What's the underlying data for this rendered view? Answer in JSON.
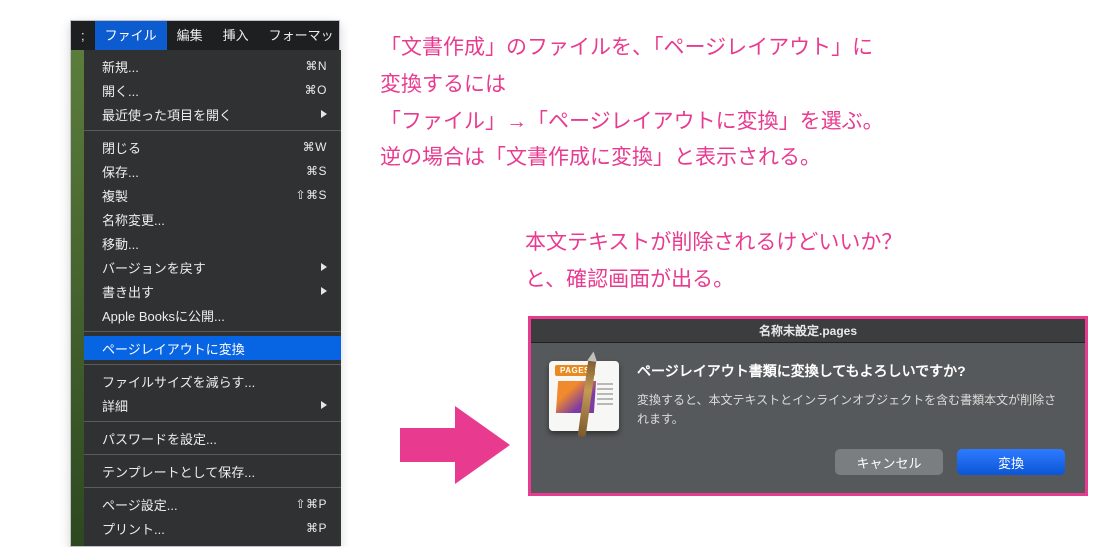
{
  "menubar": {
    "trail": ";",
    "items": [
      "ファイル",
      "編集",
      "挿入",
      "フォーマッ"
    ]
  },
  "menu": {
    "new": {
      "label": "新規...",
      "shortcut": "⌘N"
    },
    "open": {
      "label": "開く...",
      "shortcut": "⌘O"
    },
    "recent": {
      "label": "最近使った項目を開く"
    },
    "close": {
      "label": "閉じる",
      "shortcut": "⌘W"
    },
    "save": {
      "label": "保存...",
      "shortcut": "⌘S"
    },
    "duplicate": {
      "label": "複製",
      "shortcut": "⇧⌘S"
    },
    "rename": {
      "label": "名称変更..."
    },
    "move": {
      "label": "移動..."
    },
    "revert": {
      "label": "バージョンを戻す"
    },
    "export": {
      "label": "書き出す"
    },
    "applebooks": {
      "label": "Apple Booksに公開..."
    },
    "convert": {
      "label": "ページレイアウトに変換"
    },
    "reduce": {
      "label": "ファイルサイズを減らす..."
    },
    "advanced": {
      "label": "詳細"
    },
    "password": {
      "label": "パスワードを設定..."
    },
    "template": {
      "label": "テンプレートとして保存..."
    },
    "pagesetup": {
      "label": "ページ設定...",
      "shortcut": "⇧⌘P"
    },
    "print": {
      "label": "プリント...",
      "shortcut": "⌘P"
    }
  },
  "magenta": {
    "para1": "「文書作成」のファイルを、「ページレイアウト」に\n変換するには\n「ファイル」→「ページレイアウトに変換」を選ぶ。\n逆の場合は「文書作成に変換」と表示される。",
    "para2": "本文テキストが削除されるけどいいか？\nと、確認画面が出る。"
  },
  "dialog": {
    "title": "名称未設定.pages",
    "icon_tag": "PAGES",
    "heading": "ページレイアウト書類に変換してもよろしいですか?",
    "body": "変換すると、本文テキストとインラインオブジェクトを含む書類本文が削除されます。",
    "cancel": "キャンセル",
    "confirm": "変換"
  }
}
